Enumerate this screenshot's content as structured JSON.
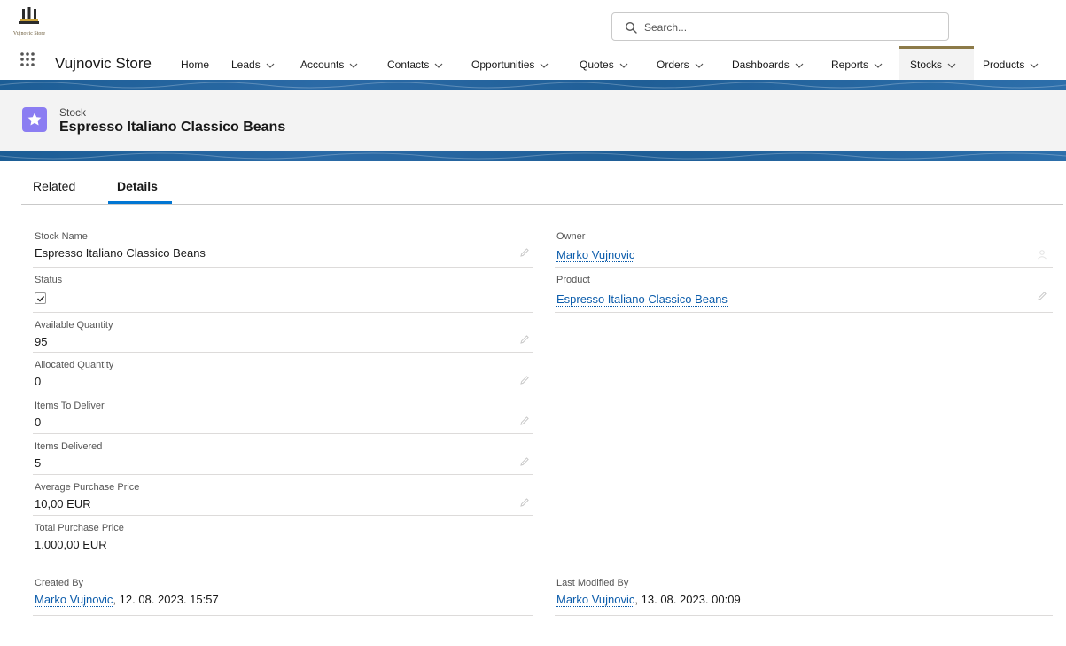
{
  "header": {
    "logo_text": "Vujnovic Store",
    "search_placeholder": "Search..."
  },
  "nav": {
    "app_name": "Vujnovic Store",
    "items": [
      {
        "label": "Home",
        "has_menu": false
      },
      {
        "label": "Leads",
        "has_menu": true
      },
      {
        "label": "Accounts",
        "has_menu": true
      },
      {
        "label": "Contacts",
        "has_menu": true
      },
      {
        "label": "Opportunities",
        "has_menu": true
      },
      {
        "label": "Quotes",
        "has_menu": true
      },
      {
        "label": "Orders",
        "has_menu": true
      },
      {
        "label": "Dashboards",
        "has_menu": true
      },
      {
        "label": "Reports",
        "has_menu": true
      },
      {
        "label": "Stocks",
        "has_menu": true,
        "active": true
      },
      {
        "label": "Products",
        "has_menu": true
      }
    ]
  },
  "record": {
    "type": "Stock",
    "title": "Espresso Italiano Classico Beans",
    "icon": "star-icon",
    "icon_color": "#8b7df2"
  },
  "tabs": {
    "related": "Related",
    "details": "Details",
    "active": "details"
  },
  "fields": {
    "stock_name": {
      "label": "Stock Name",
      "value": "Espresso Italiano Classico Beans"
    },
    "status": {
      "label": "Status",
      "checked": true
    },
    "available_quantity": {
      "label": "Available Quantity",
      "value": "95"
    },
    "allocated_quantity": {
      "label": "Allocated Quantity",
      "value": "0"
    },
    "items_to_deliver": {
      "label": "Items To Deliver",
      "value": "0"
    },
    "items_delivered": {
      "label": "Items Delivered",
      "value": "5"
    },
    "average_purchase_price": {
      "label": "Average Purchase Price",
      "value": "10,00 EUR"
    },
    "total_purchase_price": {
      "label": "Total Purchase Price",
      "value": "1.000,00 EUR"
    },
    "owner": {
      "label": "Owner",
      "value": "Marko Vujnovic"
    },
    "product": {
      "label": "Product",
      "value": "Espresso Italiano Classico Beans"
    },
    "created_by": {
      "label": "Created By",
      "user": "Marko Vujnovic",
      "separator": ",",
      "timestamp": "12. 08. 2023. 15:57"
    },
    "last_modified_by": {
      "label": "Last Modified By",
      "user": "Marko Vujnovic",
      "separator": ",",
      "timestamp": "13. 08. 2023. 00:09"
    }
  },
  "colors": {
    "link": "#0b5cab",
    "tab_active": "#0176d3",
    "banner_strip": "#1f5e96",
    "nav_active_border": "#8c7a48"
  }
}
